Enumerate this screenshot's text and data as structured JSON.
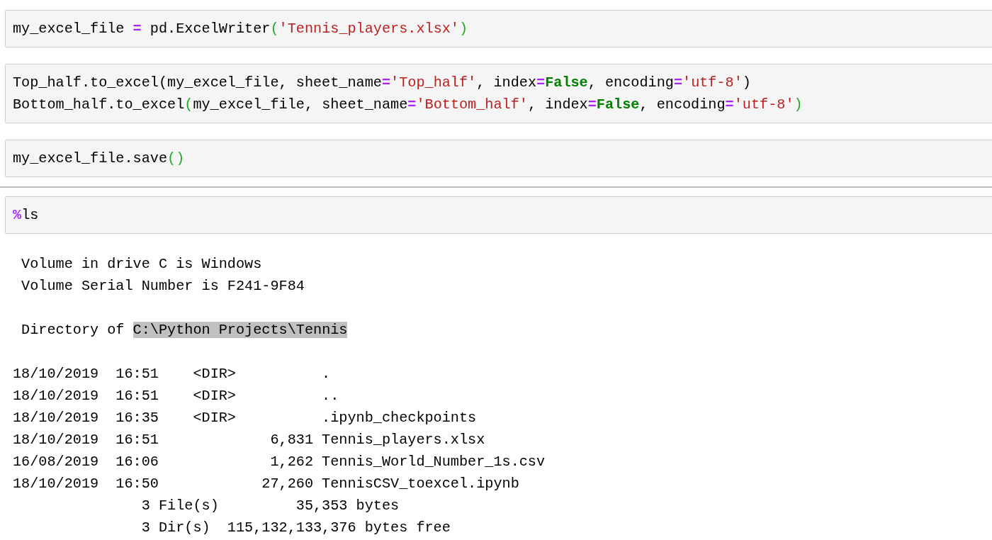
{
  "cells": [
    {
      "lines": [
        [
          {
            "kind": "plain",
            "text": "my_excel_file "
          },
          {
            "kind": "operator",
            "text": "="
          },
          {
            "kind": "plain",
            "text": " pd.ExcelWriter"
          },
          {
            "kind": "paren",
            "text": "("
          },
          {
            "kind": "string",
            "text": "'Tennis_players.xlsx'"
          },
          {
            "kind": "paren",
            "text": ")"
          }
        ]
      ]
    },
    {
      "lines": [
        [
          {
            "kind": "plain",
            "text": "Top_half.to_excel(my_excel_file, sheet_name"
          },
          {
            "kind": "operator",
            "text": "="
          },
          {
            "kind": "string",
            "text": "'Top_half'"
          },
          {
            "kind": "plain",
            "text": ", index"
          },
          {
            "kind": "operator",
            "text": "="
          },
          {
            "kind": "keyword",
            "text": "False"
          },
          {
            "kind": "plain",
            "text": ", encoding"
          },
          {
            "kind": "operator",
            "text": "="
          },
          {
            "kind": "string",
            "text": "'utf-8'"
          },
          {
            "kind": "plain",
            "text": ")"
          }
        ],
        [
          {
            "kind": "plain",
            "text": "Bottom_half.to_excel"
          },
          {
            "kind": "paren",
            "text": "("
          },
          {
            "kind": "plain",
            "text": "my_excel_file, sheet_name"
          },
          {
            "kind": "operator",
            "text": "="
          },
          {
            "kind": "string",
            "text": "'Bottom_half'"
          },
          {
            "kind": "plain",
            "text": ", index"
          },
          {
            "kind": "operator",
            "text": "="
          },
          {
            "kind": "keyword",
            "text": "False"
          },
          {
            "kind": "plain",
            "text": ", encoding"
          },
          {
            "kind": "operator",
            "text": "="
          },
          {
            "kind": "string",
            "text": "'utf-8'"
          },
          {
            "kind": "paren",
            "text": ")"
          }
        ]
      ]
    },
    {
      "lines": [
        [
          {
            "kind": "plain",
            "text": "my_excel_file.save"
          },
          {
            "kind": "paren",
            "text": "()"
          }
        ]
      ]
    },
    {
      "lines": [
        [
          {
            "kind": "operator",
            "text": "%"
          },
          {
            "kind": "plain",
            "text": "ls"
          }
        ]
      ],
      "output": [
        [
          [
            {
              "text": " Volume in drive C is Windows",
              "selected": false
            }
          ],
          [
            {
              "text": " Volume Serial Number is F241-9F84",
              "selected": false
            }
          ]
        ],
        [
          [
            {
              "text": " Directory of ",
              "selected": false
            },
            {
              "text": "C:\\Python Projects\\Tennis",
              "selected": true
            }
          ]
        ],
        [
          [
            {
              "text": "18/10/2019  16:51    <DIR>          .",
              "selected": false
            }
          ],
          [
            {
              "text": "18/10/2019  16:51    <DIR>          ..",
              "selected": false
            }
          ],
          [
            {
              "text": "18/10/2019  16:35    <DIR>          .ipynb_checkpoints",
              "selected": false
            }
          ],
          [
            {
              "text": "18/10/2019  16:51             6,831 Tennis_players.xlsx",
              "selected": false
            }
          ],
          [
            {
              "text": "16/08/2019  16:06             1,262 Tennis_World_Number_1s.csv",
              "selected": false
            }
          ],
          [
            {
              "text": "18/10/2019  16:50            27,260 TennisCSV_toexcel.ipynb",
              "selected": false
            }
          ],
          [
            {
              "text": "               3 File(s)         35,353 bytes",
              "selected": false
            }
          ],
          [
            {
              "text": "               3 Dir(s)  115,132,133,376 bytes free",
              "selected": false
            }
          ]
        ]
      ]
    }
  ]
}
